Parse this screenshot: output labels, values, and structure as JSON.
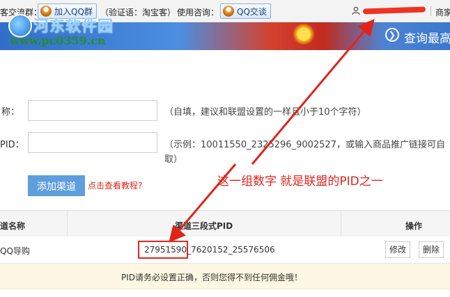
{
  "topbar": {
    "group_label": "客交流群：",
    "join_qq_group": "加入QQ群",
    "verify_text": "（验证语：淘宝客）",
    "consult_label": "使用咨询：",
    "qq_chat": "QQ交谈",
    "right_link": "商家"
  },
  "banner": {
    "site_name": "河东软件园",
    "site_url": "www.pc0359.cn",
    "query_text": "查询最高"
  },
  "form": {
    "name_label": "称：",
    "name_value": "",
    "name_hint": "（自填，建议和联盟设置的一样且小于10个字符）",
    "pid_label": "PID：",
    "pid_value": "",
    "pid_hint_line1": "（示例：10011550_2325296_9002527，或输入商品推广链接可自",
    "pid_hint_line2": "取）",
    "add_button": "添加渠道",
    "tutorial_link": "点击查看教程?"
  },
  "annotation": "这一组数字 就是联盟的PID之一",
  "table": {
    "headers": [
      "道名称",
      "渠道三段式PID",
      "操作"
    ],
    "rows": [
      {
        "name": "QQ导购",
        "pid": "27951590_7620152_25576506",
        "edit": "修改",
        "delete": "删除"
      }
    ]
  },
  "notice": "PID请务必设置正确，否则您得不到任何佣金哦！",
  "colors": {
    "accent": "#5e9edc",
    "annotation_red": "#e0241b",
    "notice_bg": "#fdf7e3"
  }
}
